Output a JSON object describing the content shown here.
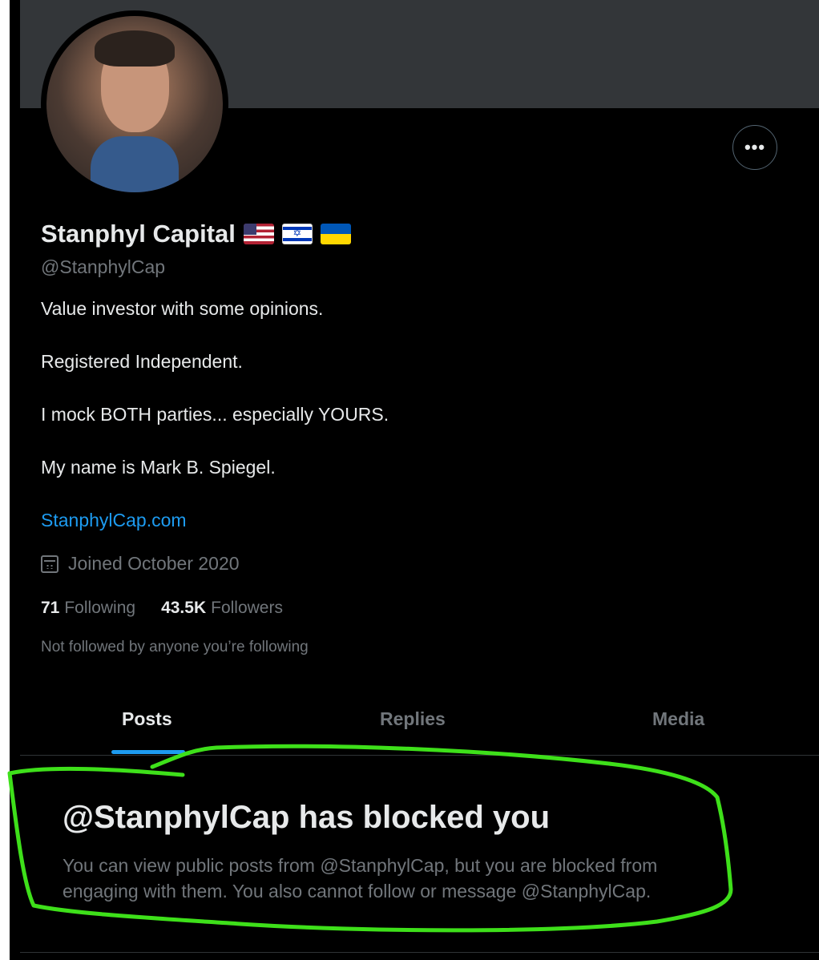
{
  "profile": {
    "name": "Stanphyl Capital",
    "handle": "@StanphylCap",
    "flags": [
      "us-flag-icon",
      "israel-flag-icon",
      "ukraine-flag-icon"
    ],
    "bio": [
      "Value investor with some opinions.",
      "Registered Independent.",
      "I mock BOTH parties... especially YOURS.",
      "My name is Mark B. Spiegel."
    ],
    "website": "StanphylCap.com",
    "joined": "Joined October 2020",
    "following_count": "71",
    "following_label": "Following",
    "followers_count": "43.5K",
    "followers_label": "Followers",
    "not_followed": "Not followed by anyone you’re following",
    "more_button": "•••"
  },
  "tabs": [
    {
      "label": "Posts",
      "active": true
    },
    {
      "label": "Replies",
      "active": false
    },
    {
      "label": "Media",
      "active": false
    }
  ],
  "blocked": {
    "title": "@StanphylCap has blocked you",
    "text": "You can view public posts from @StanphylCap, but you are blocked from engaging with them. You also cannot follow or message @StanphylCap."
  },
  "colors": {
    "background": "#000000",
    "banner": "#333639",
    "accent": "#1d9bf0",
    "annotation": "#3ee01a"
  }
}
